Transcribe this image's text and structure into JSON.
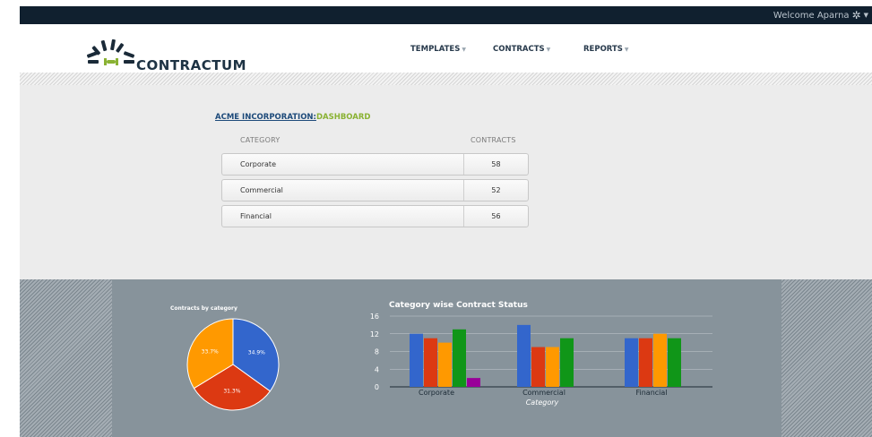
{
  "topbar": {
    "welcome": "Welcome Aparna",
    "icon": "gear-icon"
  },
  "brand": {
    "name": "CONTRACTUM",
    "colors": {
      "rays": "#1a2a38",
      "accent": "#8ab233"
    }
  },
  "nav": {
    "items": [
      {
        "label": "TEMPLATES"
      },
      {
        "label": "CONTRACTS"
      },
      {
        "label": "REPORTS"
      }
    ]
  },
  "dashboard": {
    "company": "ACME INCORPORATION:",
    "section": "DASHBOARD",
    "columns": {
      "category": "CATEGORY",
      "contracts": "CONTRACTS"
    },
    "rows": [
      {
        "category": "Corporate",
        "contracts": "58"
      },
      {
        "category": "Commercial",
        "contracts": "52"
      },
      {
        "category": "Financial",
        "contracts": "56"
      }
    ]
  },
  "chart_data": [
    {
      "type": "pie",
      "title": "Contracts by category",
      "slices": [
        {
          "label": "34.9%",
          "value": 34.9,
          "color": "#3366cc"
        },
        {
          "label": "31.3%",
          "value": 31.3,
          "color": "#dc3912"
        },
        {
          "label": "33.7%",
          "value": 33.7,
          "color": "#ff9900"
        }
      ]
    },
    {
      "type": "bar",
      "title": "Category wise Contract Status",
      "xlabel": "Category",
      "ylabel": "",
      "ylim": [
        0,
        16
      ],
      "yticks": [
        "0",
        "4",
        "8",
        "12",
        "16"
      ],
      "categories": [
        "Corporate",
        "Commercial",
        "Financial"
      ],
      "series": [
        {
          "values": [
            12,
            14,
            11
          ],
          "color": "#3366cc"
        },
        {
          "values": [
            11,
            9,
            11
          ],
          "color": "#dc3912"
        },
        {
          "values": [
            10,
            9,
            12
          ],
          "color": "#ff9900"
        },
        {
          "values": [
            13,
            11,
            11
          ],
          "color": "#109618"
        },
        {
          "values": [
            2,
            0,
            0
          ],
          "color": "#990099"
        }
      ],
      "grid": true,
      "legend": "none"
    }
  ]
}
